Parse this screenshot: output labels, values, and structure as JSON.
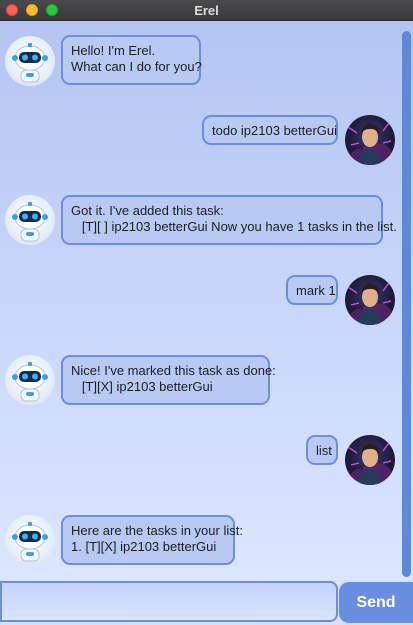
{
  "window": {
    "title": "Erel"
  },
  "messages": [
    {
      "sender": "bot",
      "text": "Hello! I'm Erel.\nWhat can I do for you?"
    },
    {
      "sender": "user",
      "text": "todo ip2103 betterGui"
    },
    {
      "sender": "bot",
      "text": "Got it. I've added this task:\n   [T][ ] ip2103 betterGui Now you have 1 tasks in the list."
    },
    {
      "sender": "user",
      "text": "mark 1"
    },
    {
      "sender": "bot",
      "text": "Nice! I've marked this task as done:\n   [T][X] ip2103 betterGui"
    },
    {
      "sender": "user",
      "text": "list"
    },
    {
      "sender": "bot",
      "text": "Here are the tasks in your list:\n1. [T][X] ip2103 betterGui"
    }
  ],
  "input": {
    "value": "",
    "placeholder": ""
  },
  "send_label": "Send",
  "icons": {
    "bot": "robot-avatar-icon",
    "user": "user-avatar-icon"
  },
  "colors": {
    "bubble": "#b8c9f3",
    "bubble_border": "#6d8fd8",
    "send": "#6a8fe0",
    "chat_top": "#b4c5f2",
    "chat_bottom": "#dbe6ff"
  }
}
